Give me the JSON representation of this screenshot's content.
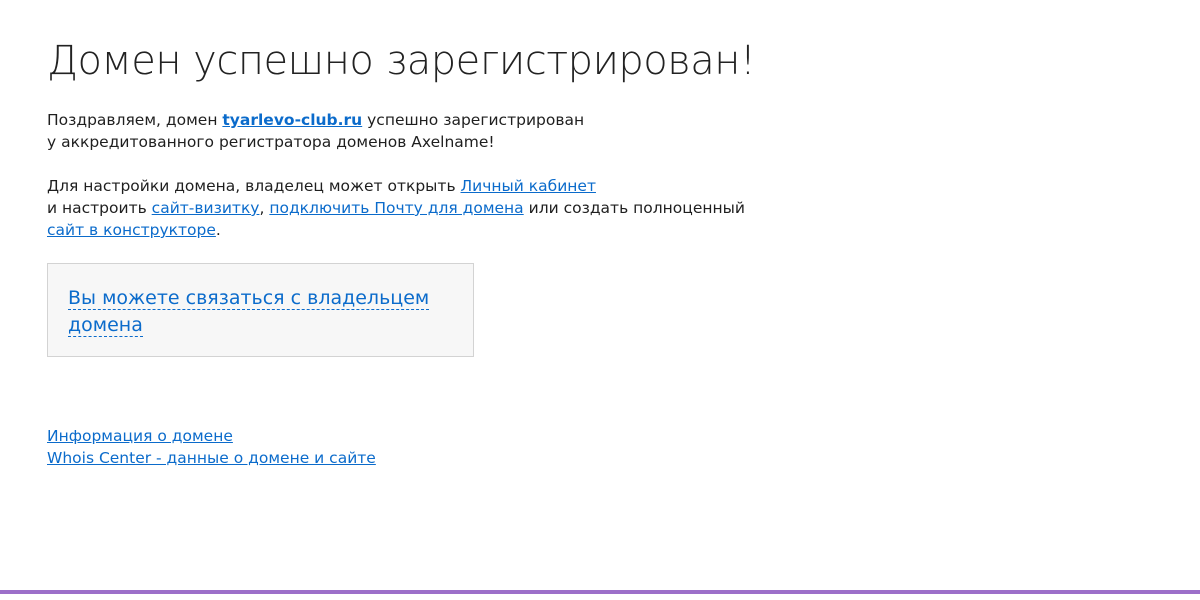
{
  "title": "Домен успешно зарегистрирован!",
  "intro": {
    "prefix": "Поздравляем, домен ",
    "domain": "tyarlevo-club.ru",
    "suffix_line1": " успешно зарегистрирован",
    "line2": "у аккредитованного регистратора доменов Axelname!"
  },
  "setup": {
    "prefix": "Для настройки домена, владелец может открыть ",
    "cabinet_link": "Личный кабинет",
    "line2_prefix": "и настроить ",
    "card_link": "сайт-визитку",
    "comma": ", ",
    "mail_link": "подключить Почту для домена",
    "middle": " или создать полноценный ",
    "builder_link": "сайт в конструкторе",
    "end": "."
  },
  "contact_box": {
    "link": "Вы можете связаться с владельцем домена"
  },
  "footer": {
    "info_link": "Информация о домене",
    "whois_link": "Whois Center - данные о домене и сайте"
  },
  "colors": {
    "link": "#0b6bcb",
    "bottom_bar": "#9c6fc9",
    "box_background": "#f7f7f7"
  }
}
